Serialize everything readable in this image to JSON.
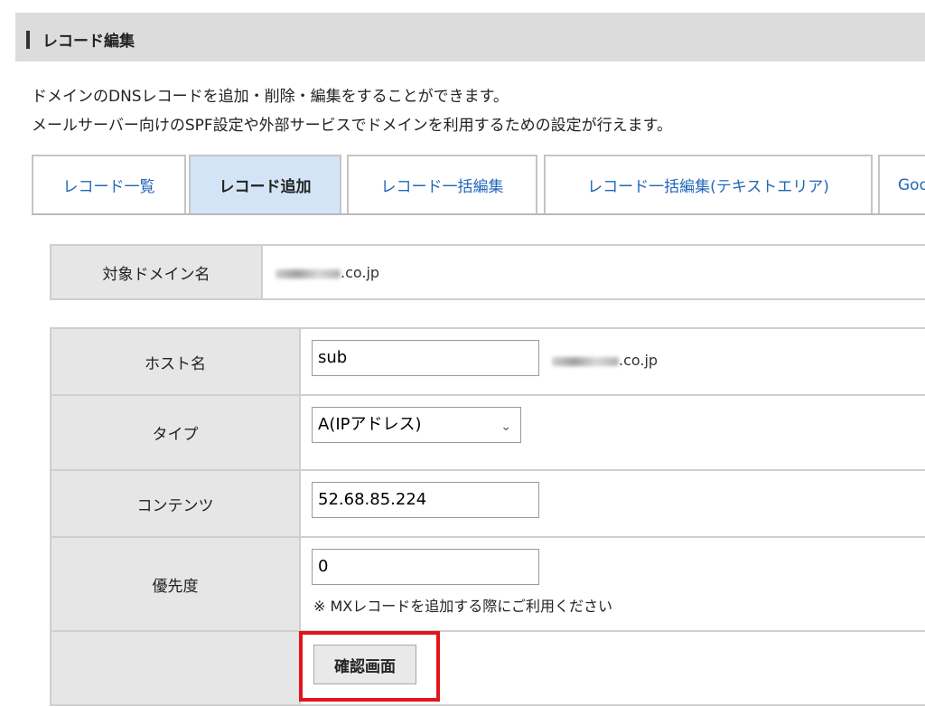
{
  "header": {
    "title": "レコード編集"
  },
  "description": [
    "ドメインのDNSレコードを追加・削除・編集をすることができます。",
    "メールサーバー向けのSPF設定や外部サービスでドメインを利用するための設定が行えます。"
  ],
  "tabs": [
    {
      "label": "レコード一覧"
    },
    {
      "label": "レコード追加",
      "active": true
    },
    {
      "label": "レコード一括編集"
    },
    {
      "label": "レコード一括編集(テキストエリア)"
    },
    {
      "label": "Goo"
    }
  ],
  "domain": {
    "label": "対象ドメイン名",
    "suffix": ".co.jp"
  },
  "form": {
    "host": {
      "label": "ホスト名",
      "value": "sub",
      "suffix": ".co.jp"
    },
    "type": {
      "label": "タイプ",
      "selected": "A(IPアドレス)"
    },
    "content": {
      "label": "コンテンツ",
      "value": "52.68.85.224"
    },
    "priority": {
      "label": "優先度",
      "value": "0",
      "note": "※  MXレコードを追加する際にご利用ください"
    },
    "confirm_label": "確認画面"
  },
  "colors": {
    "highlight": "#e1151b",
    "tab_active": "#d3e4f6",
    "link": "#2167b8"
  }
}
